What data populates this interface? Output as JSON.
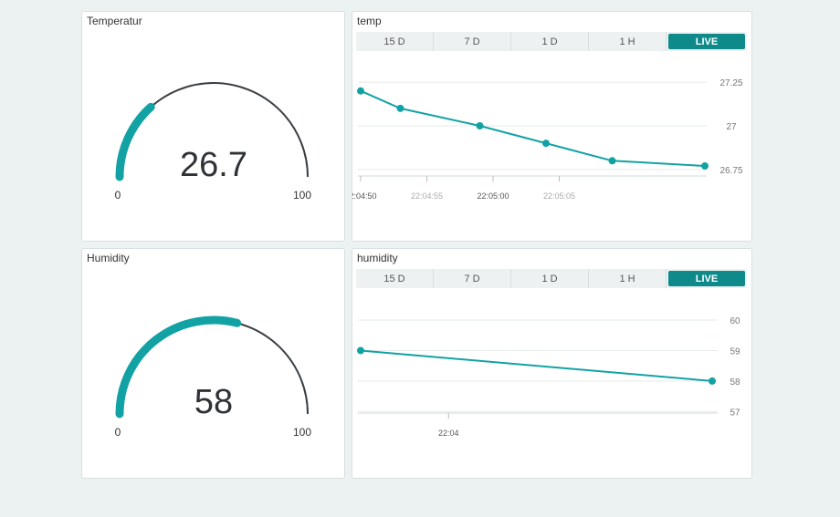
{
  "colors": {
    "accent": "#13a2a4",
    "active_tab": "#0e8a8a",
    "gauge_track": "#3a3f44",
    "grid": "#e6ebeb"
  },
  "widgets": {
    "temp_gauge": {
      "title": "Temperatur",
      "value": 26.7,
      "value_label": "26.7",
      "min": 0,
      "max": 100,
      "min_label": "0",
      "max_label": "100"
    },
    "hum_gauge": {
      "title": "Humidity",
      "value": 58,
      "value_label": "58",
      "min": 0,
      "max": 100,
      "min_label": "0",
      "max_label": "100"
    },
    "temp_chart": {
      "title": "temp",
      "tabs": [
        "15 D",
        "7 D",
        "1 D",
        "1 H",
        "LIVE"
      ],
      "active_tab": 4
    },
    "hum_chart": {
      "title": "humidity",
      "tabs": [
        "15 D",
        "7 D",
        "1 D",
        "1 H",
        "LIVE"
      ],
      "active_tab": 4
    }
  },
  "chart_data": [
    {
      "type": "line",
      "title": "",
      "x": [
        "22:04:50",
        "22:04:53",
        "22:04:59",
        "22:05:04",
        "22:05:09",
        "22:05:16"
      ],
      "series": [
        {
          "values": [
            27.2,
            27.1,
            27.0,
            26.9,
            26.8,
            26.77
          ]
        }
      ],
      "xticks": [
        "22:04:50",
        "22:04:55",
        "22:05:00",
        "22:05:05"
      ],
      "xtick_emphasis": [
        true,
        false,
        true,
        false
      ],
      "yticks": [
        "27.25",
        "27",
        "26.75"
      ],
      "ylim": [
        26.65,
        27.35
      ],
      "grid": true
    },
    {
      "type": "line",
      "title": "",
      "x": [
        "22:03:55",
        "22:04:15"
      ],
      "series": [
        {
          "values": [
            59,
            58
          ]
        }
      ],
      "xticks": [
        "22:04"
      ],
      "yticks": [
        "60",
        "59",
        "58",
        "57"
      ],
      "ylim": [
        56.8,
        60.6
      ],
      "grid": true
    }
  ]
}
